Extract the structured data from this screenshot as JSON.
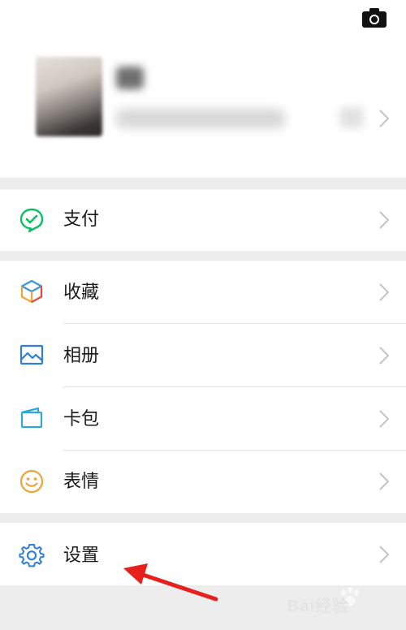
{
  "menu": {
    "pay": {
      "label": "支付",
      "icon": "wechat-pay-icon"
    },
    "favorites": {
      "label": "收藏",
      "icon": "cube-icon"
    },
    "album": {
      "label": "相册",
      "icon": "picture-icon"
    },
    "cards": {
      "label": "卡包",
      "icon": "card-wallet-icon"
    },
    "stickers": {
      "label": "表情",
      "icon": "smiley-icon"
    },
    "settings": {
      "label": "设置",
      "icon": "gear-icon"
    }
  },
  "colors": {
    "pay_green": "#07c160",
    "settings_blue": "#2f7fd8",
    "smiley_orange": "#f0a33a",
    "arrow_red": "#e5201d"
  },
  "watermark": {
    "text": "Bai经验"
  }
}
